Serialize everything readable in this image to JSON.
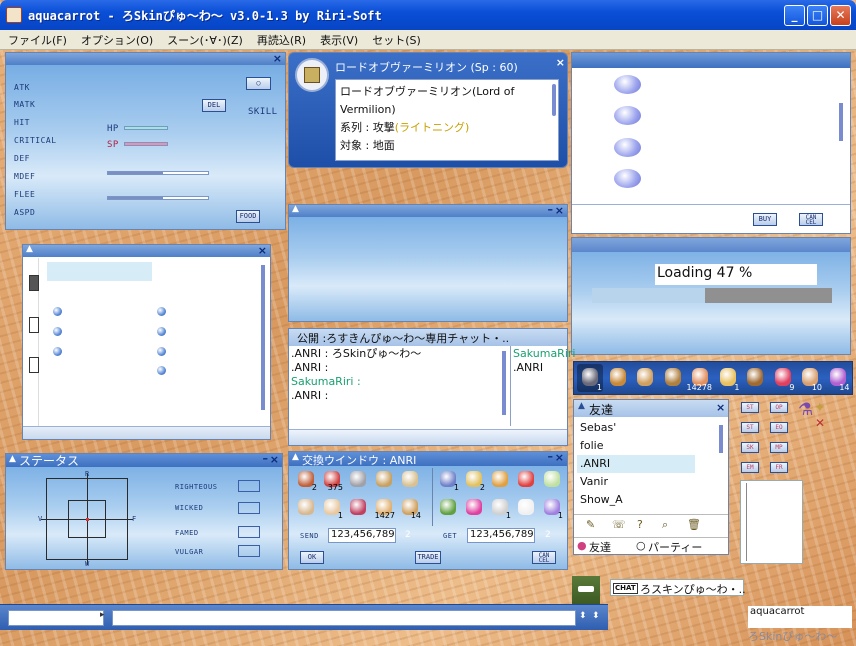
{
  "window": {
    "title": "aquacarrot - ろSkinぴゅ～わ～ v3.0-1.3 by Riri-Soft",
    "minimize": "_",
    "maximize": "□",
    "close": "✕"
  },
  "menu": [
    "ファイル(F)",
    "オプション(O)",
    "スーン(･∀･)(Z)",
    "再読込(R)",
    "表示(V)",
    "セット(S)"
  ],
  "stats": {
    "labels": [
      "ATK",
      "MATK",
      "HIT",
      "CRITICAL",
      "DEF",
      "MDEF",
      "FLEE",
      "ASPD"
    ],
    "del": "DEL",
    "skill": "SKILL",
    "hp": "HP",
    "sp": "SP",
    "food": "FOOD",
    "hp_fill": 1.0,
    "sp_fill": 1.0,
    "bar1_fill": 0.55,
    "bar2_fill": 0.55
  },
  "skill": {
    "header": "ロードオブヴァーミリオン (Sp : 60)",
    "name": "ロードオブヴァーミリオン(Lord of Vermilion)",
    "type_label": "系列 : 攻撃",
    "type_value": "(ライトニング)",
    "target": "対象 : 地面"
  },
  "shop": {
    "buy": "BUY",
    "cancel": "CAN CEL"
  },
  "loading": {
    "text": "Loading 47 %",
    "progress": 0.47
  },
  "chat": {
    "header": "公開 :ろすきんぴゅ～わ～専用チャット・..",
    "lines": [
      ".ANRI : ろSkinぴゅ～わ～",
      ".ANRI :",
      "SakumaRiri :",
      ".ANRI :"
    ],
    "right": [
      "SakumaRiri",
      ".ANRI"
    ]
  },
  "hotbar": {
    "counts": [
      "1",
      "",
      "",
      "",
      "14278",
      "1",
      "",
      "9",
      "10",
      "14"
    ]
  },
  "friends": {
    "header": "友達",
    "items": [
      "Sebas'",
      "folie",
      ".ANRI",
      "Vanir",
      "Show_A"
    ],
    "selected": 2,
    "tab_friend": "友達",
    "tab_party": "パーティー"
  },
  "status": {
    "header": "ステータス",
    "labels": [
      "RIGHTEOUS",
      "WICKED",
      "FAMED",
      "VULGAR"
    ],
    "axis": [
      "R",
      "W",
      "V",
      "F"
    ]
  },
  "trade": {
    "header": "交換ウインドウ : ANRI",
    "send": "SEND",
    "get": "GET",
    "send_value": "123,456,789",
    "get_value": "123,456,789",
    "count_send": "2",
    "count_get": "2",
    "ok": "OK",
    "trade": "TRADE",
    "cancel": "CAN CEL",
    "left_counts": [
      "2",
      "375",
      "",
      "",
      "",
      "",
      "1",
      "",
      "1427",
      "14"
    ],
    "right_counts": [
      "1",
      "2",
      "",
      "",
      "",
      "",
      "",
      "1",
      "",
      "1"
    ]
  },
  "statbtns": [
    "ST",
    "OP",
    "ST",
    "EO",
    "SK",
    "MP",
    "EM",
    "FR"
  ],
  "bottom": {
    "chat_badge": "CHAT",
    "chat_title": "ろスキンぴゅ～わ・..",
    "name": "aquacarrot",
    "footer": "ろSkinぴゅ～わ～"
  },
  "colors": {
    "accent": "#2a62d8",
    "sky": "#8fbbe6",
    "sand": "#e0a56a"
  }
}
